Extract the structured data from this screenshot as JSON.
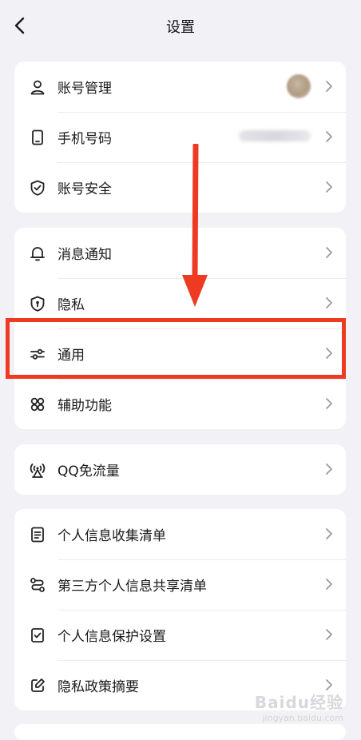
{
  "header": {
    "title": "设置"
  },
  "groups": [
    {
      "items": [
        {
          "label": "账号管理",
          "icon": "person-icon",
          "trailing": "avatar"
        },
        {
          "label": "手机号码",
          "icon": "phone-icon",
          "trailing": "blurred"
        },
        {
          "label": "账号安全",
          "icon": "shield-check-icon"
        }
      ]
    },
    {
      "items": [
        {
          "label": "消息通知",
          "icon": "bell-icon"
        },
        {
          "label": "隐私",
          "icon": "privacy-shield-icon"
        },
        {
          "label": "通用",
          "icon": "sliders-icon"
        },
        {
          "label": "辅助功能",
          "icon": "grid-icon"
        }
      ]
    },
    {
      "items": [
        {
          "label": "QQ免流量",
          "icon": "signal-tower-icon"
        }
      ]
    },
    {
      "items": [
        {
          "label": "个人信息收集清单",
          "icon": "document-list-icon"
        },
        {
          "label": "第三方个人信息共享清单",
          "icon": "share-flow-icon"
        },
        {
          "label": "个人信息保护设置",
          "icon": "checkbox-icon"
        },
        {
          "label": "隐私政策摘要",
          "icon": "edit-icon"
        }
      ]
    }
  ],
  "annotation": {
    "highlight_color": "#ee3a22"
  },
  "watermark": {
    "text": "Baidu经验",
    "sub": "jingyan.baidu.com"
  }
}
